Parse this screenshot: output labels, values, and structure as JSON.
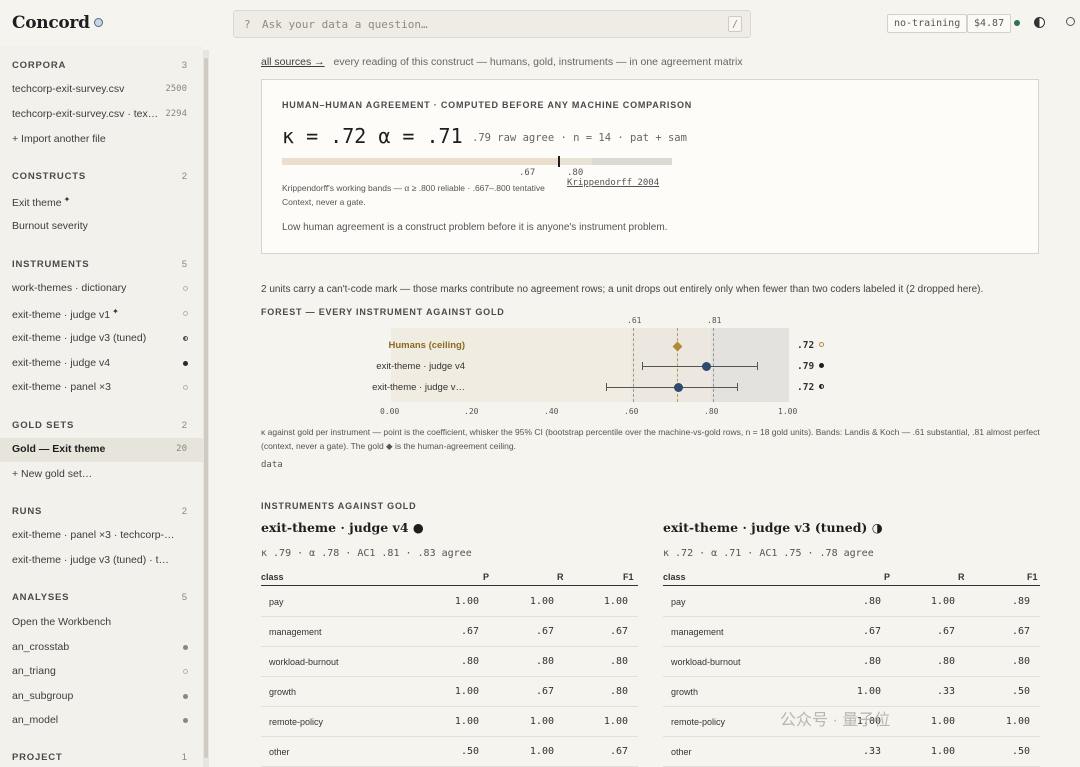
{
  "app": {
    "brand": "Concord",
    "search_placeholder": "Ask your data a question…",
    "search_prefix": "?",
    "search_shortcut": "/",
    "training_pill": "no-training",
    "cost_pill": "$4.87"
  },
  "sidebar": {
    "corpora": {
      "title": "CORPORA",
      "count": "3",
      "items": [
        {
          "label": "techcorp-exit-survey.csv",
          "num": "2500"
        },
        {
          "label": "techcorp-exit-survey.csv · tex…",
          "num": "2294"
        },
        {
          "label": "+ Import another file"
        }
      ]
    },
    "constructs": {
      "title": "CONSTRUCTS",
      "count": "2",
      "items": [
        {
          "label": "Exit theme",
          "star": "✦"
        },
        {
          "label": "Burnout severity"
        }
      ]
    },
    "instruments": {
      "title": "INSTRUMENTS",
      "count": "5",
      "items": [
        {
          "label": "work-themes · dictionary"
        },
        {
          "label": "exit-theme · judge v1",
          "star": "✦"
        },
        {
          "label": "exit-theme · judge v3 (tuned)"
        },
        {
          "label": "exit-theme · judge v4"
        },
        {
          "label": "exit-theme · panel ×3"
        }
      ]
    },
    "gold_sets": {
      "title": "GOLD SETS",
      "count": "2",
      "items": [
        {
          "label": "Gold — Exit theme",
          "num": "20"
        },
        {
          "label": "+ New gold set…"
        }
      ]
    },
    "runs": {
      "title": "RUNS",
      "count": "2",
      "items": [
        {
          "label": "exit-theme · panel ×3 · techcorp-…"
        },
        {
          "label": "exit-theme · judge v3 (tuned) · t…"
        }
      ]
    },
    "analyses": {
      "title": "ANALYSES",
      "count": "5",
      "items": [
        {
          "label": "Open the Workbench"
        },
        {
          "label": "an_crosstab"
        },
        {
          "label": "an_triang"
        },
        {
          "label": "an_subgroup"
        },
        {
          "label": "an_model"
        }
      ]
    },
    "project": {
      "title": "PROJECT",
      "count": "1"
    }
  },
  "main": {
    "breadcrumb_link": "all sources →",
    "breadcrumb_text": "every reading of this construct — humans, gold, instruments — in one agreement matrix",
    "hh": {
      "title": "HUMAN–HUMAN AGREEMENT · COMPUTED BEFORE ANY MACHINE COMPARISON",
      "big": "κ = .72  α = .71",
      "sub": ".79 raw agree · n = 14 · pat + sam",
      "value": 0.71,
      "lab_67": ".67",
      "lab_80": ".80",
      "ref": "Krippendorff 2004",
      "note1": "Krippendorff's working bands — α ≥ .800 reliable · .667–.800 tentative",
      "note2": "Context, never a gate.",
      "note3": "Low human agreement is a construct problem before it is anyone's instrument problem."
    },
    "units_note": "2 units carry a can't-code mark — those marks contribute no agreement rows; a unit drops out entirely only when fewer than two coders labeled it (2 dropped here).",
    "forest_title": "FOREST — EVERY INSTRUMENT AGAINST GOLD",
    "forest": {
      "band_labels": [
        ".61",
        ".81"
      ],
      "axis": [
        "0.00",
        ".20",
        ".40",
        ".60",
        ".80",
        "1.00"
      ],
      "rows": [
        {
          "label": "Humans (ceiling)",
          "value": ".72",
          "marker": "○"
        },
        {
          "label": "exit-theme · judge v4",
          "value": ".79",
          "marker": "●"
        },
        {
          "label": "exit-theme · judge v…",
          "value": ".72",
          "marker": "◑"
        }
      ]
    },
    "forest_caption": "κ against gold per instrument — point is the coefficient, whisker the 95% CI (bootstrap percentile over the machine-vs-gold rows, n = 18 gold units). Bands: Landis & Koch — .61 substantial, .81 almost perfect (context, never a gate). The gold ◆ is the human-agreement ceiling.",
    "data_link": "data",
    "ia_title": "INSTRUMENTS AGAINST GOLD",
    "instruments": [
      {
        "title": "exit-theme · judge v4 ●",
        "metrics": "κ .79 · α .78 · AC1 .81 · .83 agree",
        "headers": [
          "class",
          "P",
          "R",
          "F1"
        ],
        "rows": [
          [
            "pay",
            "1.00",
            "1.00",
            "1.00"
          ],
          [
            "management",
            ".67",
            ".67",
            ".67"
          ],
          [
            "workload-burnout",
            ".80",
            ".80",
            ".80"
          ],
          [
            "growth",
            "1.00",
            ".67",
            ".80"
          ],
          [
            "remote-policy",
            "1.00",
            "1.00",
            "1.00"
          ],
          [
            "other",
            ".50",
            "1.00",
            ".67"
          ]
        ]
      },
      {
        "title": "exit-theme · judge v3 (tuned) ◑",
        "metrics": "κ .72 · α .71 · AC1 .75 · .78 agree",
        "headers": [
          "class",
          "P",
          "R",
          "F1"
        ],
        "rows": [
          [
            "pay",
            ".80",
            "1.00",
            ".89"
          ],
          [
            "management",
            ".67",
            ".67",
            ".67"
          ],
          [
            "workload-burnout",
            ".80",
            ".80",
            ".80"
          ],
          [
            "growth",
            "1.00",
            ".33",
            ".50"
          ],
          [
            "remote-policy",
            "1.00",
            "1.00",
            "1.00"
          ],
          [
            "other",
            ".33",
            "1.00",
            ".50"
          ]
        ]
      }
    ],
    "watermark": "公众号 · 量子位"
  }
}
